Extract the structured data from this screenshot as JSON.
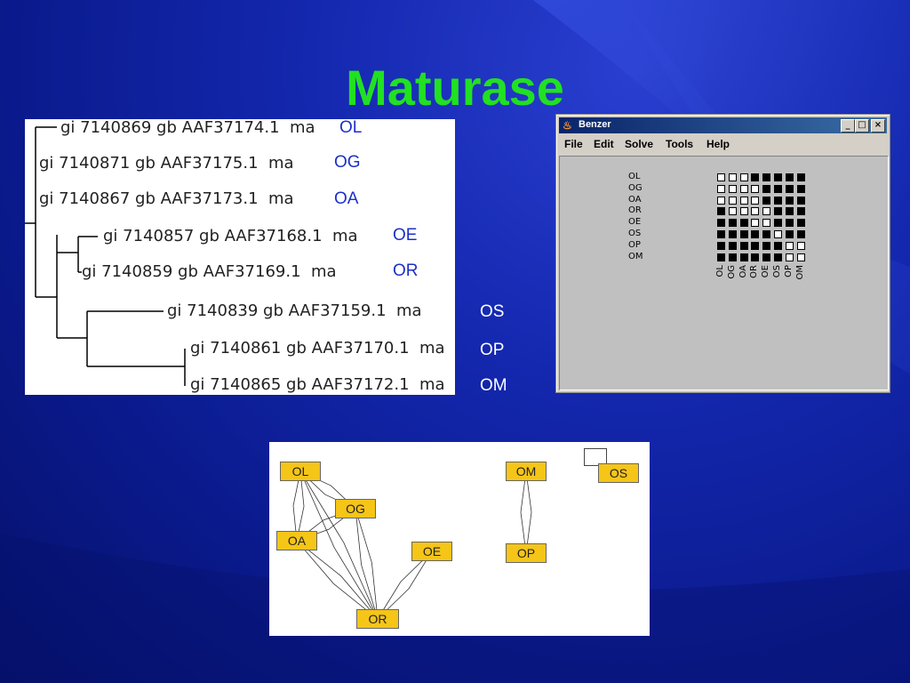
{
  "slide": {
    "title": "Maturase"
  },
  "tree": {
    "leaves": [
      {
        "text": "gi 7140869 gb AAF37174.1  ma",
        "clade": "OL"
      },
      {
        "text": "gi 7140871 gb AAF37175.1  ma",
        "clade": "OG"
      },
      {
        "text": "gi 7140867 gb AAF37173.1  ma",
        "clade": "OA"
      },
      {
        "text": "gi 7140857 gb AAF37168.1  ma",
        "clade": "OE"
      },
      {
        "text": "gi 7140859 gb AAF37169.1  ma",
        "clade": "OR"
      },
      {
        "text": "gi 7140839 gb AAF37159.1  ma",
        "clade": "OS"
      },
      {
        "text": "gi 7140861 gb AAF37170.1  ma",
        "clade": "OP"
      },
      {
        "text": "gi 7140865 gb AAF37172.1  ma",
        "clade": "OM"
      }
    ],
    "clade_color": "#1c30c8"
  },
  "benzer": {
    "title": "Benzer",
    "menus": [
      "File",
      "Edit",
      "Solve",
      "Tools",
      "Help"
    ],
    "rows": [
      "OL",
      "OG",
      "OA",
      "OR",
      "OE",
      "OS",
      "OP",
      "OM"
    ],
    "cols": [
      "OL",
      "OG",
      "OA",
      "OR",
      "OE",
      "OS",
      "OP",
      "OM"
    ],
    "matrix": [
      [
        0,
        0,
        0,
        1,
        1,
        1,
        1,
        1
      ],
      [
        0,
        0,
        0,
        0,
        1,
        1,
        1,
        1
      ],
      [
        0,
        0,
        0,
        0,
        1,
        1,
        1,
        1
      ],
      [
        1,
        0,
        0,
        0,
        0,
        1,
        1,
        1
      ],
      [
        1,
        1,
        1,
        0,
        0,
        1,
        1,
        1
      ],
      [
        1,
        1,
        1,
        1,
        1,
        0,
        1,
        1
      ],
      [
        1,
        1,
        1,
        1,
        1,
        1,
        0,
        0
      ],
      [
        1,
        1,
        1,
        1,
        1,
        1,
        0,
        0
      ]
    ],
    "buttons": {
      "minimize": "_",
      "maximize": "□",
      "close": "×"
    }
  },
  "graph": {
    "nodes": [
      "OL",
      "OG",
      "OA",
      "OE",
      "OR",
      "OM",
      "OP",
      "OS"
    ],
    "node_color": "#f5c518",
    "edges": [
      [
        "OL",
        "OA"
      ],
      [
        "OL",
        "OG"
      ],
      [
        "OA",
        "OG"
      ],
      [
        "OL",
        "OR"
      ],
      [
        "OA",
        "OR"
      ],
      [
        "OG",
        "OR"
      ],
      [
        "OE",
        "OR"
      ],
      [
        "OM",
        "OP"
      ],
      [
        "OS",
        "OS"
      ]
    ]
  }
}
